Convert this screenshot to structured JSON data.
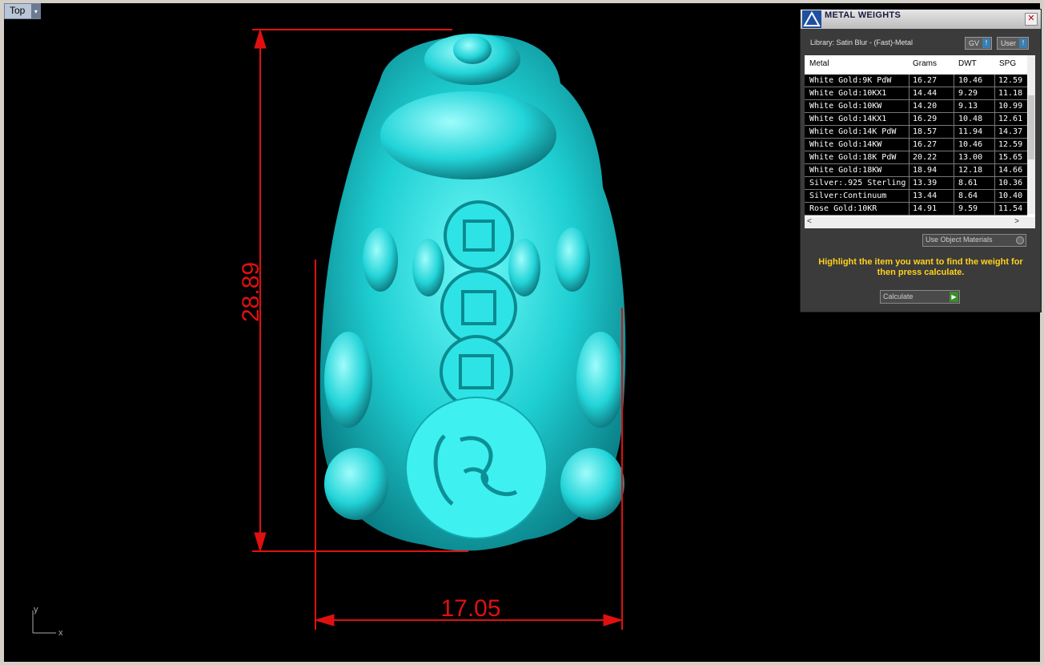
{
  "viewport": {
    "view_name": "Top",
    "dropdown_glyph": "▾",
    "axis_y": "y",
    "axis_x": "x",
    "dimensions": {
      "height": "28.89",
      "width": "17.05"
    },
    "colors": {
      "background": "#000000",
      "model": "#1ee6e6",
      "dimension": "#e01010"
    }
  },
  "panel": {
    "title": "METAL WEIGHTS",
    "logo_icon": "app-logo-icon",
    "close_glyph": "✕",
    "library": "Library: Satin Blur - (Fast)-Metal",
    "toggle_gv": "GV",
    "toggle_user": "User",
    "toggle_glyph": "!",
    "columns": [
      "Metal",
      "Grams",
      "DWT",
      "SPG"
    ],
    "rows": [
      [
        "White Gold:9K PdW",
        "16.27",
        "10.46",
        "12.59"
      ],
      [
        "White Gold:10KX1",
        "14.44",
        "9.29",
        "11.18"
      ],
      [
        "White Gold:10KW",
        "14.20",
        "9.13",
        "10.99"
      ],
      [
        "White Gold:14KX1",
        "16.29",
        "10.48",
        "12.61"
      ],
      [
        "White Gold:14K PdW",
        "18.57",
        "11.94",
        "14.37"
      ],
      [
        "White Gold:14KW",
        "16.27",
        "10.46",
        "12.59"
      ],
      [
        "White Gold:18K PdW",
        "20.22",
        "13.00",
        "15.65"
      ],
      [
        "White Gold:18KW",
        "18.94",
        "12.18",
        "14.66"
      ],
      [
        "Silver:.925 Sterling",
        "13.39",
        "8.61",
        "10.36"
      ],
      [
        "Silver:Continuum",
        "13.44",
        "8.64",
        "10.40"
      ],
      [
        "Rose Gold:10KR",
        "14.91",
        "9.59",
        "11.54"
      ]
    ],
    "scroll_left": "<",
    "scroll_right": ">",
    "use_object_materials": "Use Object Materials",
    "hint": "Highlight the item you want to find the weight for then press calculate.",
    "calculate": "Calculate",
    "calculate_glyph": "▶",
    "accent_color": "#ffd21c"
  }
}
